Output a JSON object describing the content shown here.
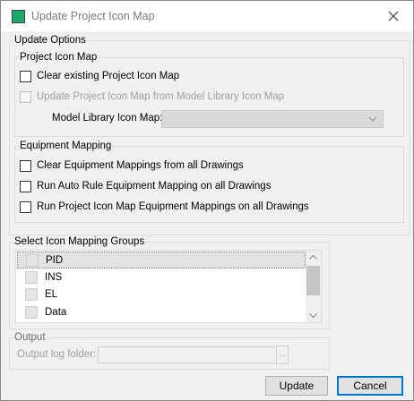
{
  "window": {
    "title": "Update Project Icon Map",
    "close_glyph": "✕"
  },
  "update_options": {
    "legend": "Update Options",
    "project_icon_map": {
      "legend": "Project Icon Map",
      "clear_label": "Clear existing Project Icon Map",
      "clear_checked": false,
      "update_from_library_label": "Update Project Icon Map from Model Library Icon Map",
      "update_from_library_enabled": false,
      "library_map_label": "Model Library Icon Map:",
      "library_map_value": ""
    },
    "equipment_mapping": {
      "legend": "Equipment Mapping",
      "items": [
        {
          "label": "Clear Equipment Mappings from all Drawings",
          "checked": false
        },
        {
          "label": "Run Auto Rule Equipment Mapping on all Drawings",
          "checked": false
        },
        {
          "label": "Run Project Icon Map Equipment Mappings on all Drawings",
          "checked": false
        }
      ]
    }
  },
  "icon_groups": {
    "legend": "Select Icon Mapping Groups",
    "items": [
      {
        "label": "PID",
        "checked": false,
        "selected": true
      },
      {
        "label": "INS",
        "checked": false,
        "selected": false
      },
      {
        "label": "EL",
        "checked": false,
        "selected": false
      },
      {
        "label": "Data",
        "checked": false,
        "selected": false
      }
    ]
  },
  "output": {
    "legend": "Output",
    "folder_label": "Output log folder:",
    "folder_value": "",
    "browse_label": "..."
  },
  "buttons": {
    "update": "Update",
    "cancel": "Cancel"
  },
  "colors": {
    "app_icon": "#1fa86b",
    "default_button_border": "#0078d7",
    "disabled_text": "#a0a0a0"
  }
}
